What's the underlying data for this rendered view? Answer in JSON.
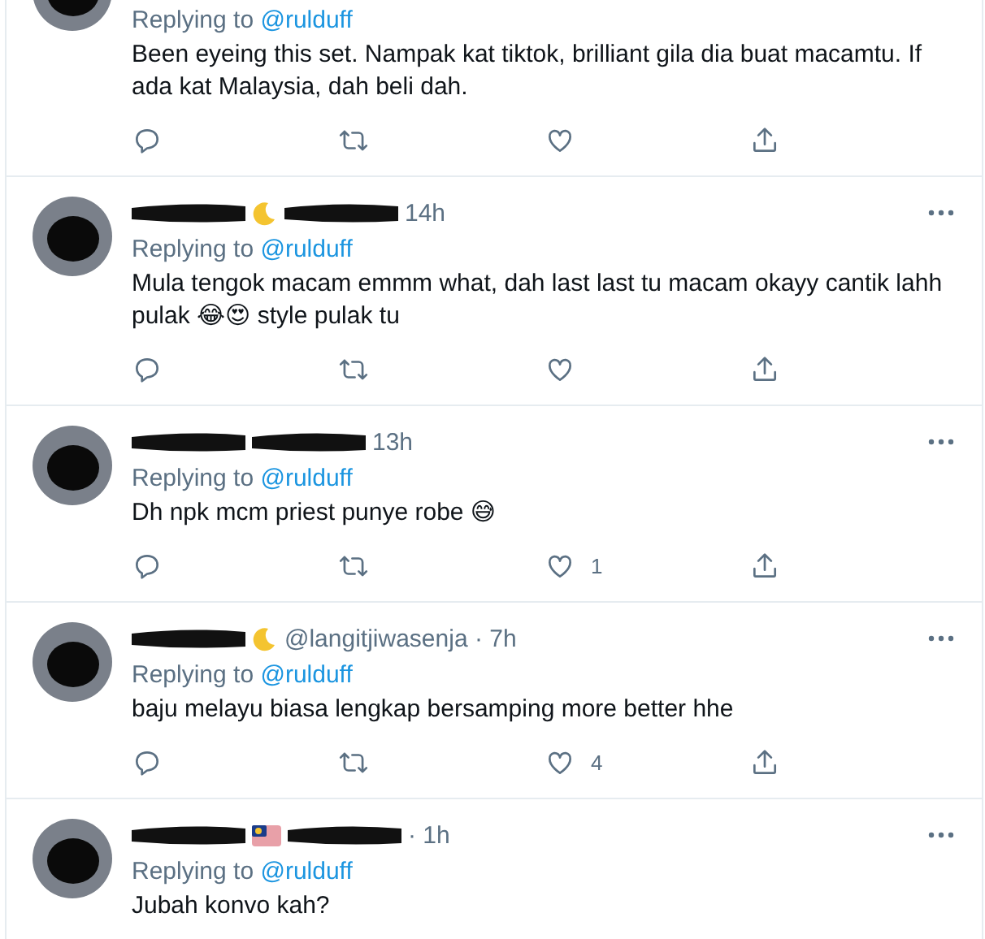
{
  "tweets": [
    {
      "reply_prefix": "Replying to",
      "reply_handle": "@rulduff",
      "text": "Been eyeing this set. Nampak kat tiktok, brilliant gila dia buat macamtu. If ada kat Malaysia, dah beli dah.",
      "actions": [
        {
          "kind": "reply"
        },
        {
          "kind": "retweet"
        },
        {
          "kind": "like"
        },
        {
          "kind": "share"
        }
      ]
    },
    {
      "header": [
        {
          "kind": "redaction"
        },
        {
          "kind": "moon"
        },
        {
          "kind": "redaction"
        },
        {
          "kind": "text",
          "text": "14h"
        }
      ],
      "reply_prefix": "Replying to",
      "reply_handle": "@rulduff",
      "text": "Mula tengok macam emmm what, dah last last tu macam okayy cantik lahh pulak 😂😍 style pulak tu",
      "actions": [
        {
          "kind": "reply"
        },
        {
          "kind": "retweet"
        },
        {
          "kind": "like"
        },
        {
          "kind": "share"
        }
      ]
    },
    {
      "header": [
        {
          "kind": "redaction"
        },
        {
          "kind": "redaction"
        },
        {
          "kind": "text",
          "text": "13h"
        }
      ],
      "reply_prefix": "Replying to",
      "reply_handle": "@rulduff",
      "text": "Dh npk mcm priest punye robe 😅",
      "actions": [
        {
          "kind": "reply"
        },
        {
          "kind": "retweet"
        },
        {
          "kind": "like",
          "count": "1"
        },
        {
          "kind": "share"
        }
      ]
    },
    {
      "header": [
        {
          "kind": "redaction"
        },
        {
          "kind": "moon"
        },
        {
          "kind": "text",
          "text": "@langitjiwasenja · 7h"
        }
      ],
      "reply_prefix": "Replying to",
      "reply_handle": "@rulduff",
      "text": "baju melayu biasa lengkap bersamping more better hhe",
      "actions": [
        {
          "kind": "reply"
        },
        {
          "kind": "retweet"
        },
        {
          "kind": "like",
          "count": "4"
        },
        {
          "kind": "share"
        }
      ]
    },
    {
      "header": [
        {
          "kind": "redaction"
        },
        {
          "kind": "flag"
        },
        {
          "kind": "redaction"
        },
        {
          "kind": "text",
          "text": "· 1h"
        }
      ],
      "reply_prefix": "Replying to",
      "reply_handle": "@rulduff",
      "text": "Jubah konvo kah?"
    }
  ]
}
